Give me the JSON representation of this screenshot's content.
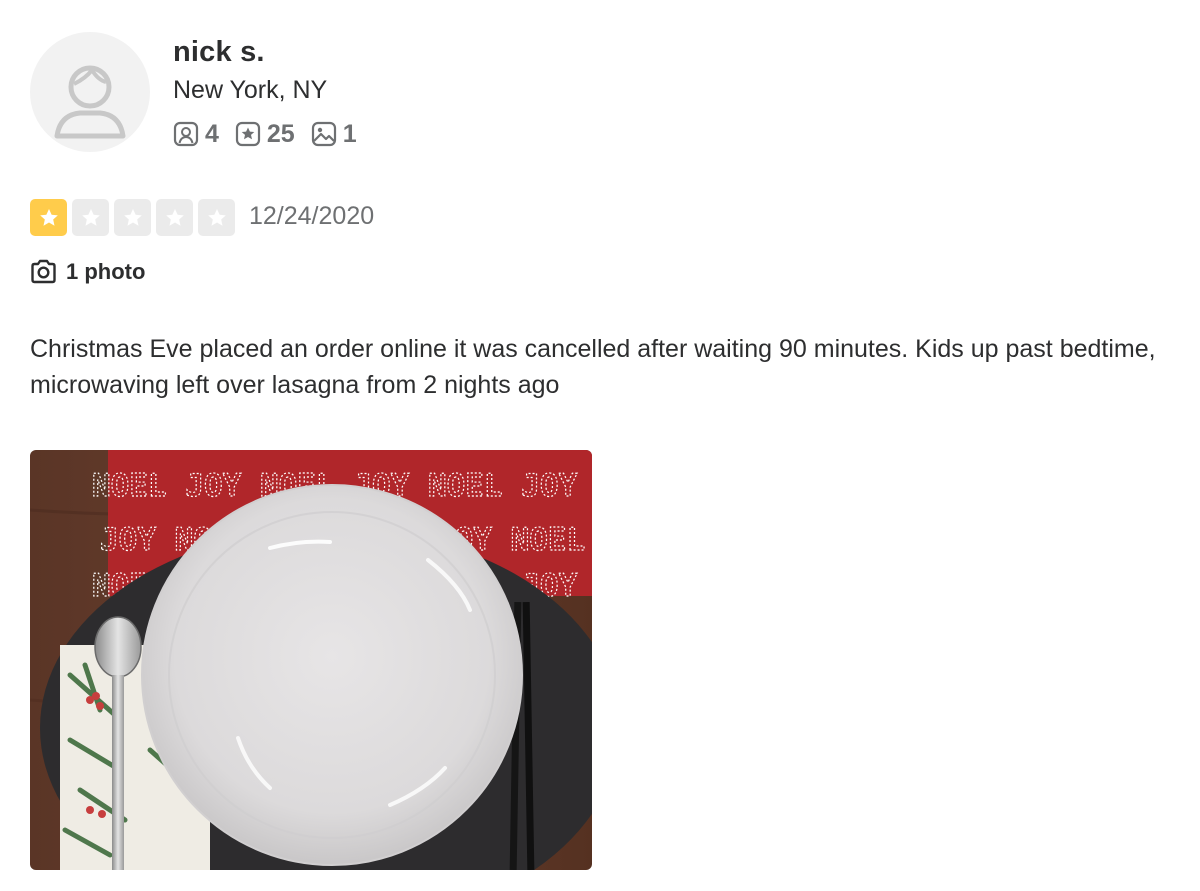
{
  "user": {
    "name": "nick s.",
    "location": "New York, NY",
    "stats": [
      {
        "icon": "friends-icon",
        "value": "4"
      },
      {
        "icon": "reviews-icon",
        "value": "25"
      },
      {
        "icon": "photos-icon",
        "value": "1"
      }
    ]
  },
  "review": {
    "rating": 1,
    "rating_max": 5,
    "date": "12/24/2020",
    "photo_count_label": "1 photo",
    "text": "Christmas Eve placed an order online it was cancelled after waiting 90 minutes. Kids up past bedtime, microwaving left over lasagna from 2 nights ago",
    "photo": {
      "placemat_words": [
        "NOEL",
        "JOY"
      ]
    }
  },
  "colors": {
    "star_filled": "#ffcc4b",
    "star_empty": "#ebebeb",
    "text_primary": "#2d2e2f",
    "text_secondary": "#6e7072"
  }
}
